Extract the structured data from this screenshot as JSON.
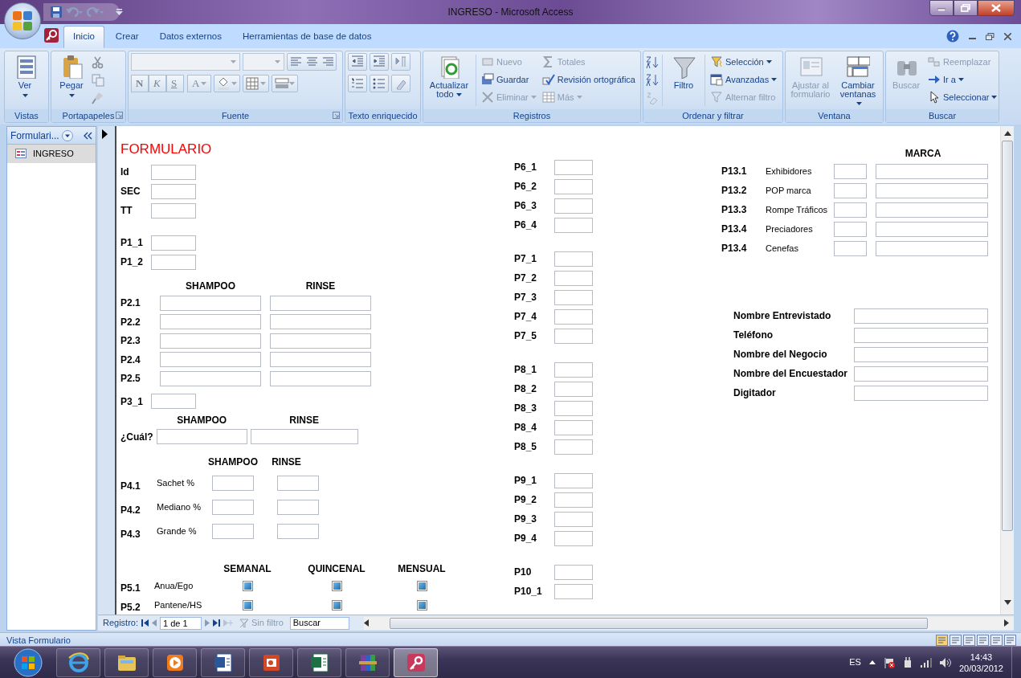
{
  "window": {
    "title": "INGRESO - Microsoft Access"
  },
  "ribbon_tabs": [
    {
      "label": "Inicio",
      "selected": true
    },
    {
      "label": "Crear",
      "selected": false
    },
    {
      "label": "Datos externos",
      "selected": false
    },
    {
      "label": "Herramientas de base de datos",
      "selected": false
    }
  ],
  "ribbon_groups": [
    {
      "label": "Vistas",
      "buttons": [
        {
          "kind": "large",
          "label": "Ver",
          "dropdown": true,
          "disabled": false
        }
      ]
    },
    {
      "label": "Portapapeles",
      "launcher": true,
      "buttons": [
        {
          "kind": "large",
          "label": "Pegar",
          "dropdown": true,
          "disabled": false
        }
      ]
    },
    {
      "label": "Fuente",
      "launcher": true,
      "buttons": [
        {
          "kind": "glyph",
          "label": "N",
          "disabled": true
        },
        {
          "kind": "glyph",
          "label": "K",
          "disabled": true
        },
        {
          "kind": "glyph",
          "label": "S",
          "disabled": true
        },
        {
          "kind": "glyph",
          "label": "A",
          "dropdown": true,
          "disabled": true
        }
      ]
    },
    {
      "label": "Texto enriquecido"
    },
    {
      "label": "Registros",
      "buttons": [
        {
          "kind": "large",
          "label": "Actualizar todo",
          "dropdown": true,
          "disabled": false
        },
        {
          "kind": "small",
          "label": "Nuevo",
          "disabled": true
        },
        {
          "kind": "small",
          "label": "Guardar",
          "disabled": false
        },
        {
          "kind": "small",
          "label": "Eliminar",
          "dropdown": true,
          "disabled": true
        },
        {
          "kind": "small",
          "label": "Totales",
          "disabled": true
        },
        {
          "kind": "small",
          "label": "Revisión ortográfica",
          "disabled": false
        },
        {
          "kind": "small",
          "label": "Más",
          "dropdown": true,
          "disabled": true
        }
      ]
    },
    {
      "label": "Ordenar y filtrar",
      "buttons": [
        {
          "kind": "large",
          "label": "Filtro",
          "disabled": false
        },
        {
          "kind": "small",
          "label": "Selección",
          "dropdown": true,
          "disabled": false
        },
        {
          "kind": "small",
          "label": "Avanzadas",
          "dropdown": true,
          "disabled": false
        },
        {
          "kind": "small",
          "label": "Alternar filtro",
          "disabled": true
        }
      ]
    },
    {
      "label": "Ventana",
      "buttons": [
        {
          "kind": "large",
          "label": "Ajustar al formulario",
          "disabled": true
        },
        {
          "kind": "large",
          "label": "Cambiar ventanas",
          "dropdown": true,
          "disabled": false
        }
      ]
    },
    {
      "label": "Buscar",
      "buttons": [
        {
          "kind": "large",
          "label": "Buscar",
          "disabled": true
        },
        {
          "kind": "small",
          "label": "Reemplazar",
          "disabled": true
        },
        {
          "kind": "small",
          "label": "Ir a",
          "dropdown": true,
          "disabled": false
        },
        {
          "kind": "small",
          "label": "Seleccionar",
          "dropdown": true,
          "disabled": false
        }
      ]
    }
  ],
  "navigation_pane": {
    "title": "Formulari...",
    "items": [
      {
        "label": "INGRESO",
        "selected": true
      }
    ]
  },
  "form": {
    "title": "FORMULARIO",
    "columns": [
      [
        {
          "kind": "fields",
          "items": [
            "Id",
            "SEC",
            "TT"
          ]
        },
        {
          "kind": "fields",
          "items": [
            "P1_1",
            "P1_2"
          ]
        },
        {
          "kind": "pairs",
          "headers": [
            "SHAMPOO",
            "RINSE"
          ],
          "rows": [
            "P2.1",
            "P2.2",
            "P2.3",
            "P2.4",
            "P2.5"
          ]
        },
        {
          "kind": "fields",
          "items": [
            "P3_1"
          ]
        },
        {
          "kind": "pairs",
          "headers": [
            "SHAMPOO",
            "RINSE"
          ],
          "rows": [
            "¿Cuál?"
          ]
        },
        {
          "kind": "percent",
          "headers": [
            "SHAMPOO",
            "RINSE"
          ],
          "rows": [
            {
              "code": "P4.1",
              "label": "Sachet %"
            },
            {
              "code": "P4.2",
              "label": "Mediano %"
            },
            {
              "code": "P4.3",
              "label": "Grande %"
            }
          ]
        },
        {
          "kind": "checks",
          "headers": [
            "SEMANAL",
            "QUINCENAL",
            "MENSUAL"
          ],
          "rows": [
            {
              "code": "P5.1",
              "label": "Anua/Ego",
              "values": [
                {
                  "indeterminate": true
                },
                {
                  "indeterminate": true
                },
                {
                  "indeterminate": true
                }
              ]
            },
            {
              "code": "P5.2",
              "label": "Pantene/HS",
              "values": [
                {
                  "indeterminate": true
                },
                {
                  "indeterminate": true
                },
                {
                  "indeterminate": true
                }
              ]
            }
          ]
        }
      ],
      [
        {
          "kind": "fields",
          "items": [
            "P6_1",
            "P6_2",
            "P6_3",
            "P6_4"
          ]
        },
        {
          "kind": "fields",
          "items": [
            "P7_1",
            "P7_2",
            "P7_3",
            "P7_4",
            "P7_5"
          ]
        },
        {
          "kind": "fields",
          "items": [
            "P8_1",
            "P8_2",
            "P8_3",
            "P8_4",
            "P8_5"
          ]
        },
        {
          "kind": "fields",
          "items": [
            "P9_1",
            "P9_2",
            "P9_3",
            "P9_4"
          ]
        },
        {
          "kind": "fields",
          "items": [
            "P10",
            "P10_1"
          ]
        }
      ],
      [
        {
          "kind": "brands",
          "header": "MARCA",
          "rows": [
            {
              "code": "P13.1",
              "label": "Exhibidores"
            },
            {
              "code": "P13.2",
              "label": "POP marca"
            },
            {
              "code": "P13.3",
              "label": "Rompe Tráficos"
            },
            {
              "code": "P13.4",
              "label": "Preciadores"
            },
            {
              "code": "P13.4",
              "label": "Cenefas"
            }
          ]
        },
        {
          "kind": "contact",
          "items": [
            "Nombre Entrevistado",
            "Teléfono",
            "Nombre del Negocio",
            "Nombre del Encuestador",
            "Digitador"
          ]
        }
      ]
    ]
  },
  "record_navigator": {
    "label": "Registro:",
    "position": "1 de 1",
    "filter": {
      "label": "Sin filtro",
      "disabled": true
    },
    "search": {
      "placeholder": "Buscar"
    }
  },
  "status_bar": {
    "text": "Vista Formulario"
  },
  "taskbar": {
    "apps": [
      {
        "selected": false
      },
      {
        "selected": false
      },
      {
        "selected": false
      },
      {
        "selected": false
      },
      {
        "selected": false
      },
      {
        "selected": false
      },
      {
        "selected": false
      },
      {
        "selected": true
      }
    ],
    "language": "ES",
    "time": "14:43",
    "date": "20/03/2012"
  }
}
